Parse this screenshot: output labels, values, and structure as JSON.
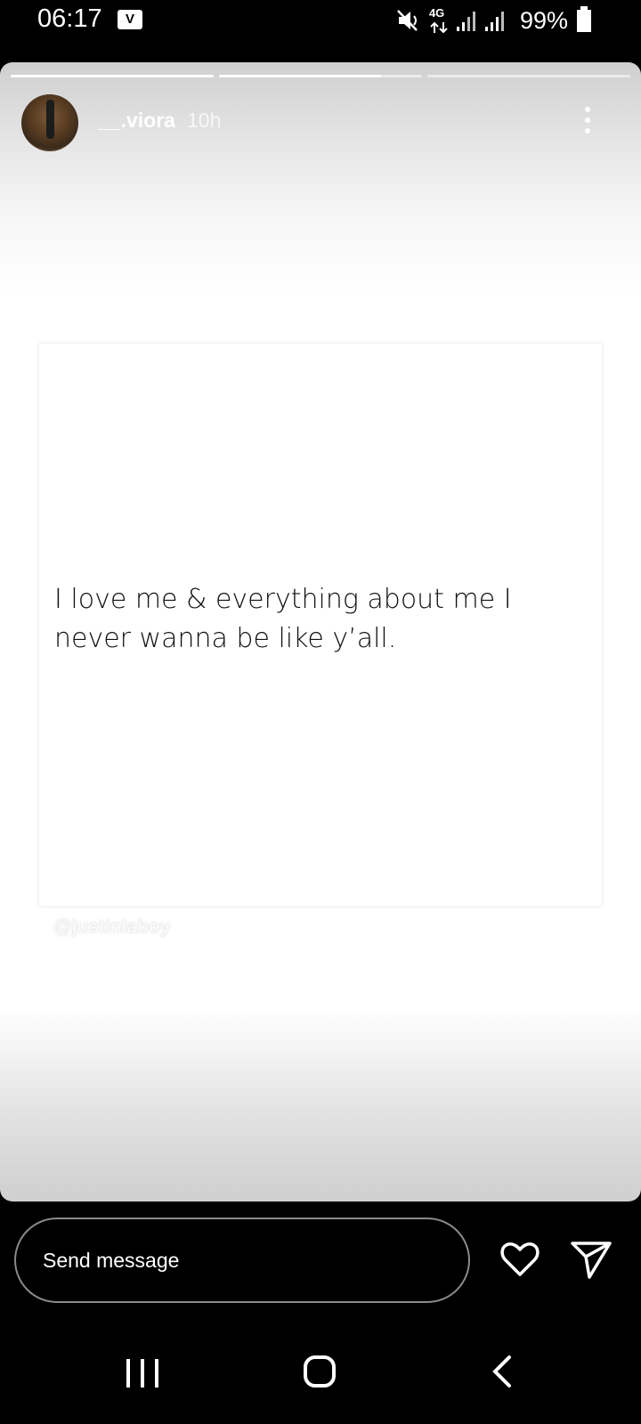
{
  "status_bar": {
    "time": "06:17",
    "battery_percent": "99%",
    "network_label": "4G",
    "app_icon_glyph": "V"
  },
  "story": {
    "progress": [
      1.0,
      0.8,
      0.0
    ],
    "username": "__.viora",
    "timestamp": "10h",
    "post_text": "I love me & everything about me I never wanna be like y’all.",
    "watermark": "@justinlaboy"
  },
  "reply": {
    "placeholder": "Send message"
  },
  "icons": {
    "more": "more-vertical-icon",
    "like": "heart-icon",
    "share": "send-icon",
    "mute": "mute-icon",
    "signal": "signal-icon",
    "battery": "battery-icon"
  },
  "colors": {
    "background": "#000000",
    "foreground": "#ffffff",
    "input_border": "#8a8a8a"
  }
}
